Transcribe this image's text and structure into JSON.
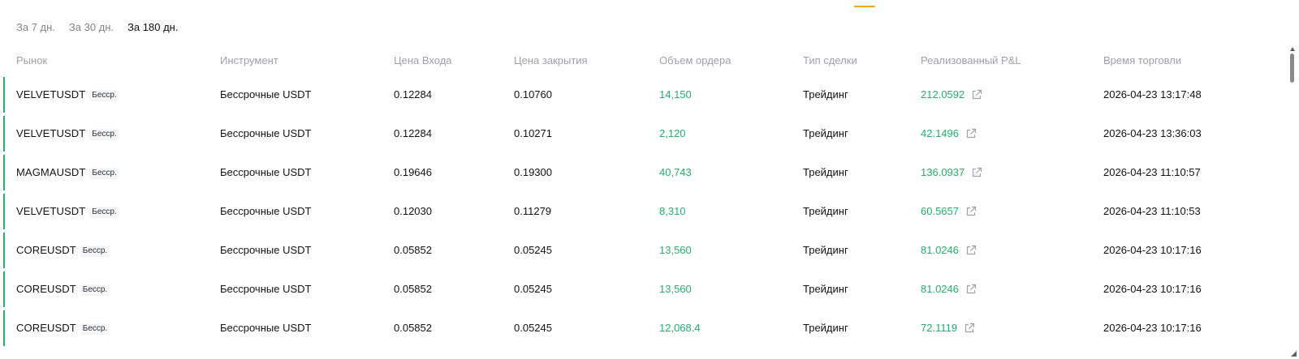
{
  "period_tabs": [
    {
      "label": "За 7 дн.",
      "active": false
    },
    {
      "label": "За 30 дн.",
      "active": false
    },
    {
      "label": "За 180 дн.",
      "active": true
    }
  ],
  "columns": {
    "market": "Рынок",
    "instrument": "Инструмент",
    "entry_price": "Цена Входа",
    "exit_price": "Цена закрытия",
    "order_volume": "Объем ордера",
    "trade_type": "Тип сделки",
    "realized_pnl": "Реализованный P&L",
    "trade_time": "Время торговли"
  },
  "rows": [
    {
      "market": "VELVETUSDT",
      "badge": "Бесср.",
      "instrument": "Бессрочные USDT",
      "entry_price": "0.12284",
      "exit_price": "0.10760",
      "order_volume": "14,150",
      "trade_type": "Трейдинг",
      "realized_pnl": "212.0592",
      "trade_time": "2026-04-23 13:17:48"
    },
    {
      "market": "VELVETUSDT",
      "badge": "Бесср.",
      "instrument": "Бессрочные USDT",
      "entry_price": "0.12284",
      "exit_price": "0.10271",
      "order_volume": "2,120",
      "trade_type": "Трейдинг",
      "realized_pnl": "42.1496",
      "trade_time": "2026-04-23 13:36:03"
    },
    {
      "market": "MAGMAUSDT",
      "badge": "Бесср.",
      "instrument": "Бессрочные USDT",
      "entry_price": "0.19646",
      "exit_price": "0.19300",
      "order_volume": "40,743",
      "trade_type": "Трейдинг",
      "realized_pnl": "136.0937",
      "trade_time": "2026-04-23 11:10:57"
    },
    {
      "market": "VELVETUSDT",
      "badge": "Бесср.",
      "instrument": "Бессрочные USDT",
      "entry_price": "0.12030",
      "exit_price": "0.11279",
      "order_volume": "8,310",
      "trade_type": "Трейдинг",
      "realized_pnl": "60.5657",
      "trade_time": "2026-04-23 11:10:53"
    },
    {
      "market": "COREUSDT",
      "badge": "Бесср.",
      "instrument": "Бессрочные USDT",
      "entry_price": "0.05852",
      "exit_price": "0.05245",
      "order_volume": "13,560",
      "trade_type": "Трейдинг",
      "realized_pnl": "81.0246",
      "trade_time": "2026-04-23 10:17:16"
    },
    {
      "market": "COREUSDT",
      "badge": "Бесср.",
      "instrument": "Бессрочные USDT",
      "entry_price": "0.05852",
      "exit_price": "0.05245",
      "order_volume": "13,560",
      "trade_type": "Трейдинг",
      "realized_pnl": "81.0246",
      "trade_time": "2026-04-23 10:17:16"
    },
    {
      "market": "COREUSDT",
      "badge": "Бесср.",
      "instrument": "Бессрочные USDT",
      "entry_price": "0.05852",
      "exit_price": "0.05245",
      "order_volume": "12,068.4",
      "trade_type": "Трейдинг",
      "realized_pnl": "72.1119",
      "trade_time": "2026-04-23 10:17:16"
    }
  ],
  "colors": {
    "positive": "#20b26c",
    "accent": "#f7a600",
    "header_text": "#a0a0a8",
    "inactive_tab": "#858585"
  },
  "icons": {
    "pnl_share": "external-link-icon"
  }
}
